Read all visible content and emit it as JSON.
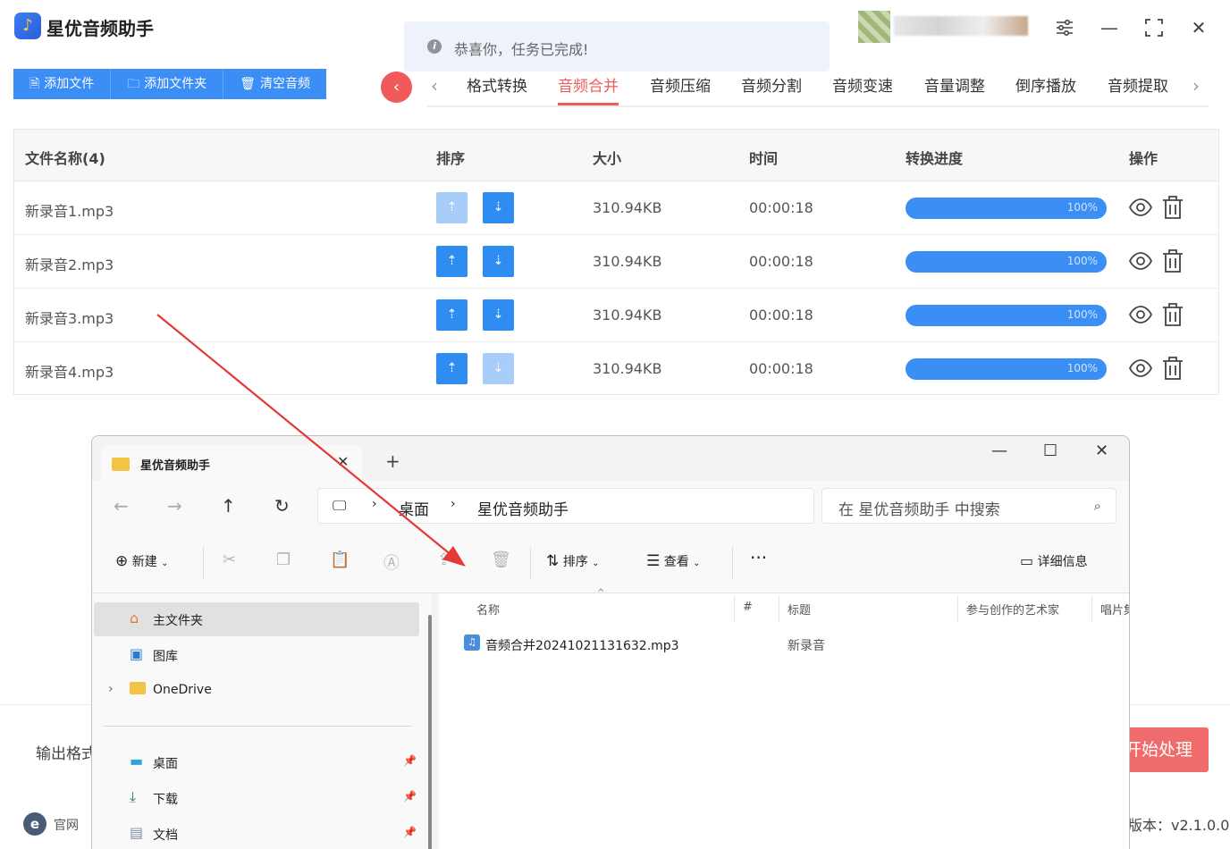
{
  "app": {
    "title": "星优音频助手"
  },
  "toast": {
    "text": "恭喜你，任务已完成!"
  },
  "toolbar": {
    "add_file": "添加文件",
    "add_folder": "添加文件夹",
    "clear": "清空音频"
  },
  "tabs": [
    "格式转换",
    "音频合并",
    "音频压缩",
    "音频分割",
    "音频变速",
    "音量调整",
    "倒序播放",
    "音频提取"
  ],
  "active_tab": "音频合并",
  "table": {
    "headers": {
      "name": "文件名称(4)",
      "sort": "排序",
      "size": "大小",
      "time": "时间",
      "progress": "转换进度",
      "action": "操作"
    },
    "rows": [
      {
        "name": "新录音1.mp3",
        "size": "310.94KB",
        "time": "00:00:18",
        "progress": "100%"
      },
      {
        "name": "新录音2.mp3",
        "size": "310.94KB",
        "time": "00:00:18",
        "progress": "100%"
      },
      {
        "name": "新录音3.mp3",
        "size": "310.94KB",
        "time": "00:00:18",
        "progress": "100%"
      },
      {
        "name": "新录音4.mp3",
        "size": "310.94KB",
        "time": "00:00:18",
        "progress": "100%"
      }
    ]
  },
  "footer": {
    "output_label": "输出格式",
    "start": "开始处理",
    "site": "官网",
    "version": "版本：v2.1.0.0"
  },
  "explorer": {
    "tab_title": "星优音频助手",
    "breadcrumb": [
      "桌面",
      "星优音频助手"
    ],
    "search_placeholder": "在 星优音频助手 中搜索",
    "commands": {
      "new": "新建",
      "sort": "排序",
      "view": "查看",
      "details": "详细信息"
    },
    "sidebar": [
      {
        "label": "主文件夹",
        "icon": "home-icon"
      },
      {
        "label": "图库",
        "icon": "gallery-icon"
      },
      {
        "label": "OneDrive",
        "icon": "folder-icon"
      },
      {
        "label": "桌面",
        "icon": "desktop-icon"
      },
      {
        "label": "下载",
        "icon": "download-icon"
      },
      {
        "label": "文档",
        "icon": "document-icon"
      }
    ],
    "columns": [
      "名称",
      "#",
      "标题",
      "参与创作的艺术家",
      "唱片集"
    ],
    "files": [
      {
        "name": "音频合并20241021131632.mp3",
        "title": "新录音"
      }
    ]
  },
  "colors": {
    "primary": "#3a8ef6",
    "accent": "#ee5b5b",
    "progress": "#3b8ff4"
  }
}
